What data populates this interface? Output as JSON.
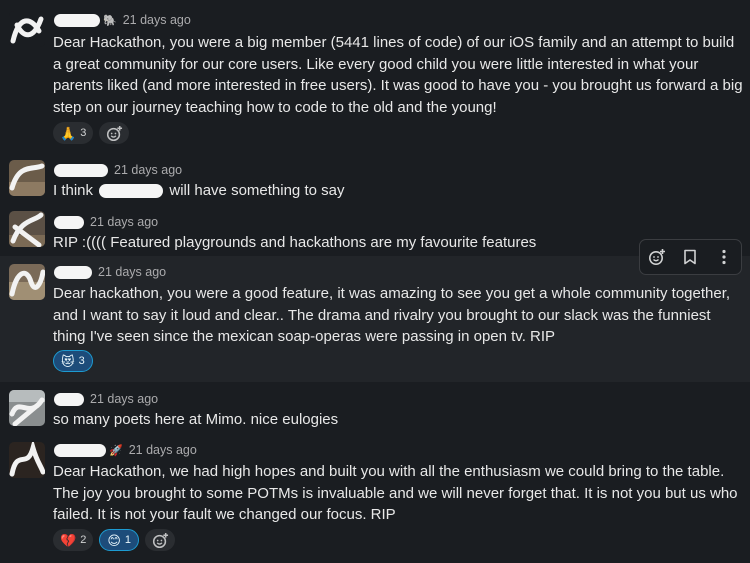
{
  "messages": [
    {
      "time": "21 days ago",
      "badge": "🐘",
      "text": "Dear Hackathon, you were a big member (5441 lines of code) of our iOS family and an attempt to build a great community for our core users. Like every good child you were little interested in what your parents liked (and more interested in free users). It was good to have you - you brought us forward a big step on our journey teaching how to code to the old and the young!",
      "reactions": [
        {
          "emoji": "🙏",
          "count": "3",
          "active": false
        }
      ]
    },
    {
      "time": "21 days ago",
      "badge": "",
      "text_before": "I think",
      "text_after": "will have something to say"
    },
    {
      "time": "21 days ago",
      "badge": "",
      "text": "RIP :(((( Featured playgrounds and hackathons are my favourite features"
    },
    {
      "time": "21 days ago",
      "badge": "",
      "text": "Dear hackathon, you were a good feature, it was amazing to see you get a whole community together, and I want to say it loud and clear.. The drama and rivalry you brought to our slack was the funniest thing I've seen since the mexican soap-operas were passing in open tv. RIP",
      "reactions": [
        {
          "emoji": "😻",
          "count": "3",
          "active": true
        }
      ]
    },
    {
      "time": "21 days ago",
      "badge": "",
      "text": "so many poets here at Mimo. nice eulogies"
    },
    {
      "time": "21 days ago",
      "badge": "🚀",
      "text": "Dear Hackathon, we had high hopes and built you with all the enthusiasm we could bring to the table. The joy you brought to some POTMs is invaluable and we will never forget that. It is not you but us who failed. It is not your fault we changed our focus. RIP",
      "reactions": [
        {
          "emoji": "💔",
          "count": "2",
          "active": false
        },
        {
          "emoji": "😊",
          "count": "1",
          "active": true
        }
      ]
    }
  ],
  "icons": {
    "add_reaction": "add-reaction-icon",
    "bookmark": "bookmark-icon",
    "more": "more-vertical-icon"
  },
  "colors": {
    "background": "#1a1d21",
    "hover_background": "#222529",
    "reaction_active": "#1d4c7a",
    "reaction_active_border": "#1d9bd1"
  }
}
